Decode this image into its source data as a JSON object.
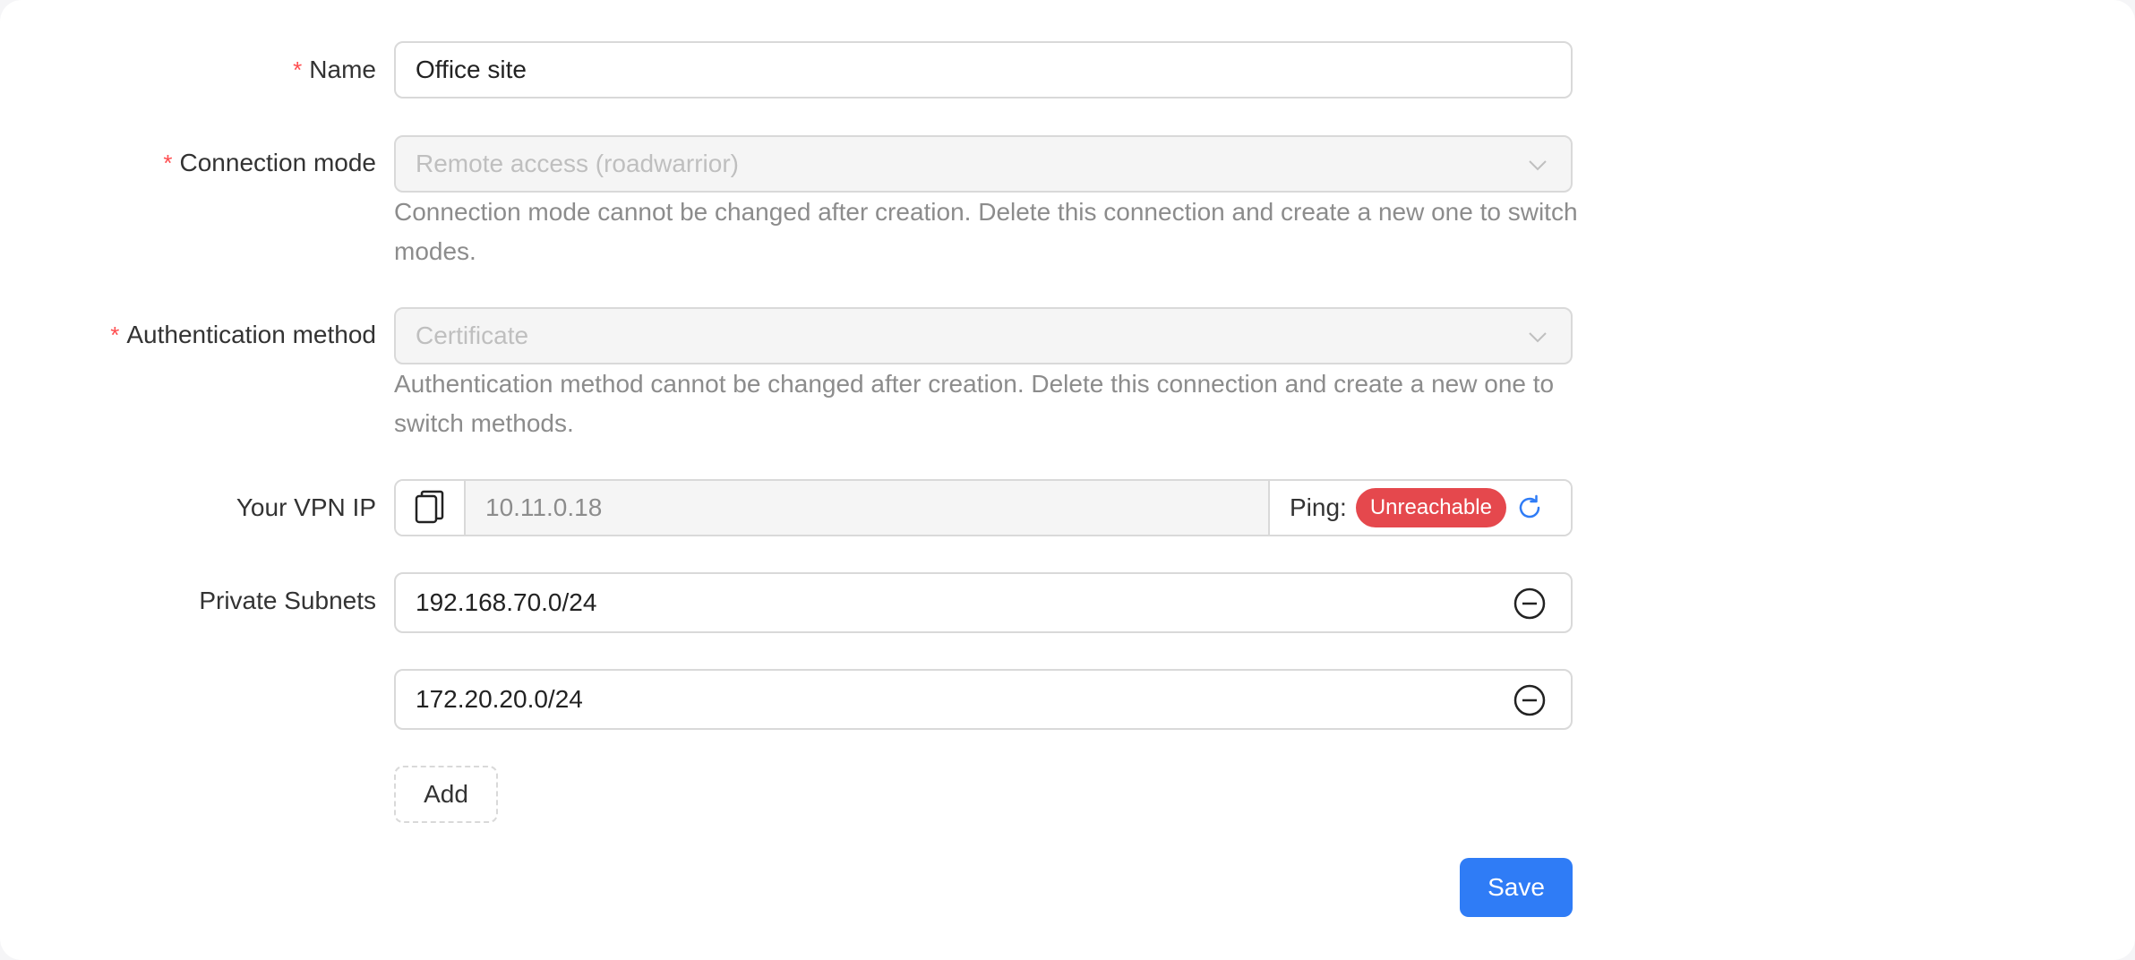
{
  "form": {
    "name": {
      "label": "Name",
      "required_mark": "*",
      "value": "Office site"
    },
    "connection_mode": {
      "label": "Connection mode",
      "required_mark": "*",
      "value": "Remote access (roadwarrior)",
      "disabled": true,
      "help": "Connection mode cannot be changed after creation. Delete this connection and create a new one to switch modes."
    },
    "auth_method": {
      "label": "Authentication method",
      "required_mark": "*",
      "value": "Certificate",
      "disabled": true,
      "help": "Authentication method cannot be changed after creation. Delete this connection and create a new one to switch methods."
    },
    "vpn_ip": {
      "label": "Your VPN IP",
      "value": "10.11.0.18",
      "copy_icon": "copy-icon",
      "ping_label": "Ping:",
      "ping_status": "Unreachable",
      "ping_status_color": "#e5484d",
      "refresh_icon": "refresh-icon"
    },
    "private_subnets": {
      "label": "Private Subnets",
      "items": [
        "192.168.70.0/24",
        "172.20.20.0/24"
      ],
      "remove_icon": "minus-circle-icon",
      "add_label": "Add"
    },
    "save_label": "Save"
  },
  "colors": {
    "accent": "#2f7cf6",
    "required": "#ff4d4f",
    "danger": "#e5484d"
  }
}
